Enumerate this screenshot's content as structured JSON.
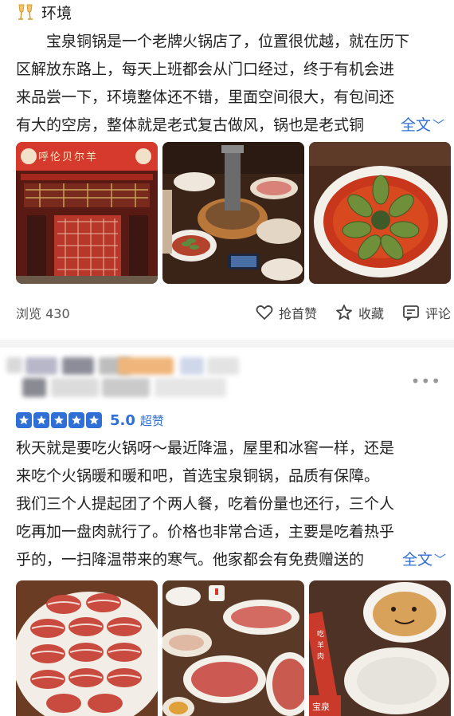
{
  "review1": {
    "lines": [
      "环境",
      "宝泉铜锅是一个老牌火锅店了，位置很优越，就在历下",
      "区解放东路上，每天上班都会从门口经过，终于有机会进",
      "来品尝一下，环境整体还不错，里面空间很大，有包间还",
      "有大的空房，整体就是老式复古做风，锅也是老式铜"
    ],
    "more_label": "全文",
    "photos": [
      {
        "icon": "restaurant-storefront-photo",
        "sign_text": "呼伦贝尔羊"
      },
      {
        "icon": "copper-hotpot-table-photo"
      },
      {
        "icon": "spicy-broth-dish-photo"
      }
    ]
  },
  "actions": {
    "views_label": "浏览 430",
    "like_label": "抢首赞",
    "collect_label": "收藏",
    "comment_label": "评论"
  },
  "review2": {
    "more_dots": "•••",
    "stars": 5,
    "score": "5.0",
    "score_label": "超赞",
    "lines": [
      "秋天就是要吃火锅呀～最近降温，屋里和冰窖一样，还是",
      "来吃个火锅暖和暖和吧，首选宝泉铜锅，品质有保障。",
      "我们三个人提起团了个两人餐，吃着份量也还行，三个人",
      "吃再加一盘肉就行了。价格也非常合适，主要是吃着热乎",
      "乎的，一扫降温带来的寒气。他家都会有免费赠送的"
    ],
    "more_label": "全文",
    "photos": [
      {
        "icon": "sliced-lamb-plate-photo"
      },
      {
        "icon": "meat-platters-table-photo"
      },
      {
        "icon": "sesame-sauce-bowl-photo",
        "label_text": "宝泉"
      }
    ]
  },
  "colors": {
    "accent": "#2f6fd6",
    "divider": "#f4f4f4"
  }
}
